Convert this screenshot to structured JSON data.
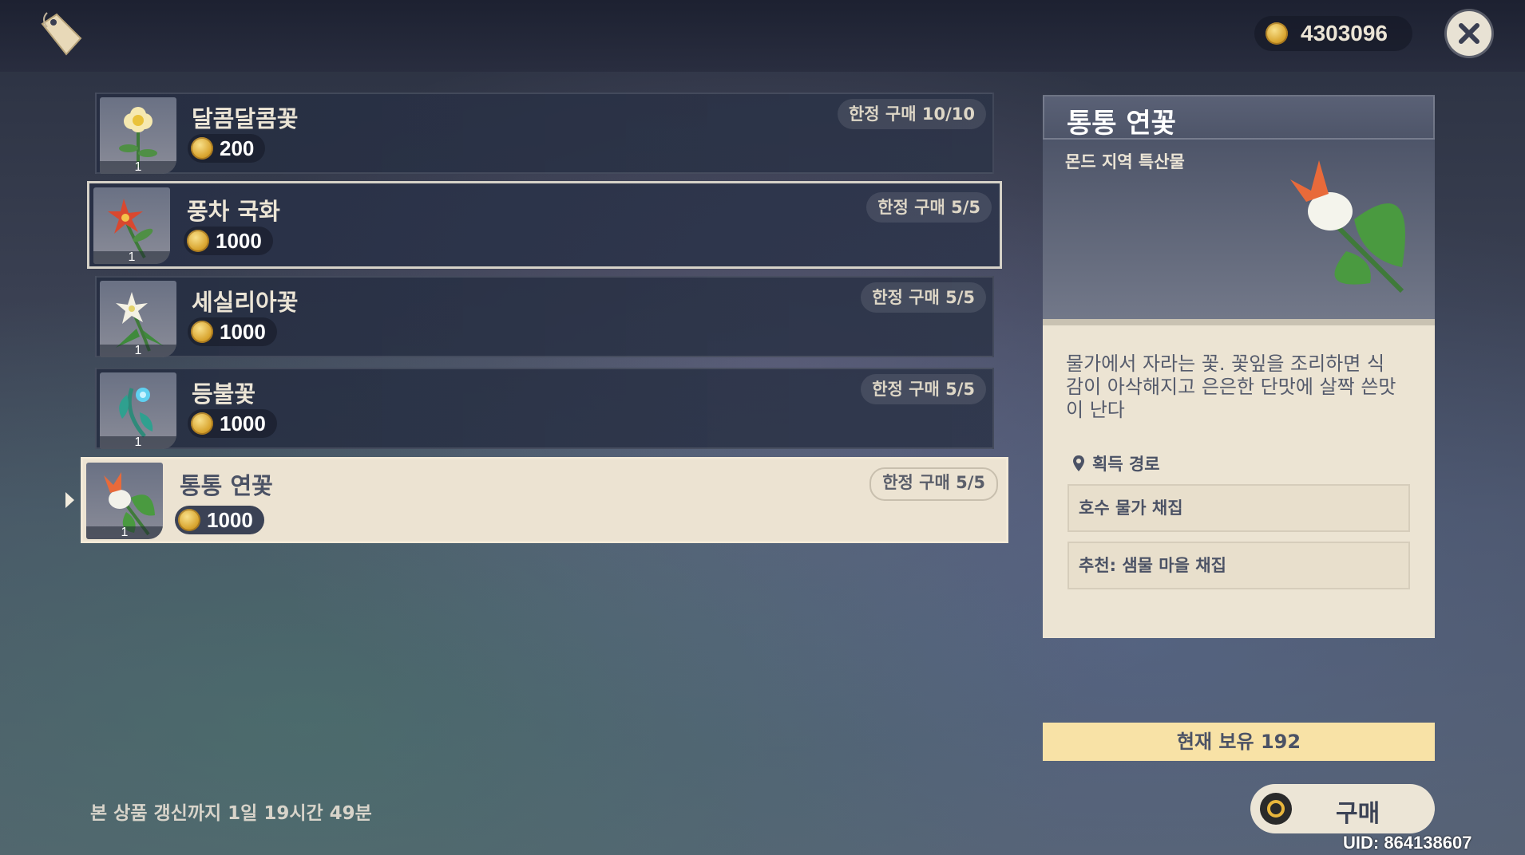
{
  "currency": {
    "amount": "4303096",
    "icon": "mora-coin-icon"
  },
  "items": [
    {
      "name": "달콤달콤꽃",
      "price": "200",
      "limit": "한정 구매 10/10",
      "qty": "1",
      "icon": "sweet-flower-icon"
    },
    {
      "name": "풍차 국화",
      "price": "1000",
      "limit": "한정 구매 5/5",
      "qty": "1",
      "icon": "windwheel-aster-icon"
    },
    {
      "name": "세실리아꽃",
      "price": "1000",
      "limit": "한정 구매 5/5",
      "qty": "1",
      "icon": "cecilia-icon"
    },
    {
      "name": "등불꽃",
      "price": "1000",
      "limit": "한정 구매 5/5",
      "qty": "1",
      "icon": "small-lamp-grass-icon"
    },
    {
      "name": "통통 연꽃",
      "price": "1000",
      "limit": "한정 구매 5/5",
      "qty": "1",
      "icon": "calla-lily-icon"
    }
  ],
  "detail": {
    "title": "통통 연꽃",
    "subtitle": "몬드 지역 특산물",
    "description": "물가에서 자라는 꽃. 꽃잎을 조리하면 식감이 아삭해지고 은은한 단맛에 살짝 쓴맛이 난다",
    "route_label": "획득 경로",
    "routes": [
      "호수 물가 채집",
      "추천: 샘물 마을 채집"
    ],
    "owned": "현재 보유 192"
  },
  "buy_label": "구매",
  "refresh_text": "본 상품 갱신까지 1일 19시간 49분",
  "uid": "UID: 864138607"
}
